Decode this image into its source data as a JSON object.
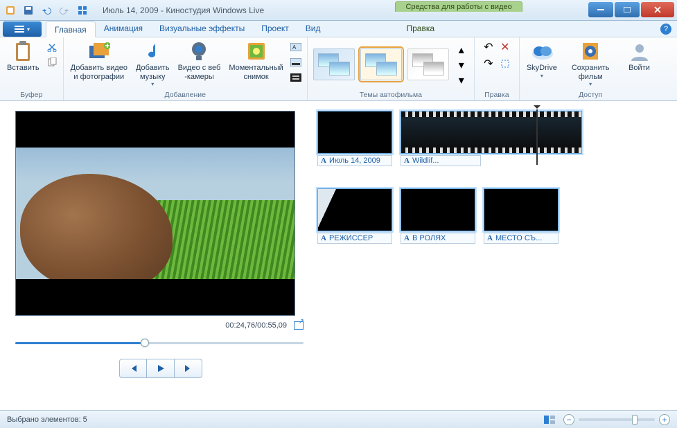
{
  "title": "Июль 14, 2009 - Киностудия Windows Live",
  "context_header": "Средства для работы с видео",
  "tabs": {
    "home": "Главная",
    "animation": "Анимация",
    "effects": "Визуальные эффекты",
    "project": "Проект",
    "view": "Вид",
    "edit": "Правка"
  },
  "ribbon": {
    "buffer": {
      "label": "Буфер",
      "paste": "Вставить"
    },
    "add": {
      "label": "Добавление",
      "add_media": "Добавить видео\nи фотографии",
      "add_music": "Добавить\nмузыку",
      "webcam": "Видео с веб\n-камеры",
      "snapshot": "Моментальный\nснимок"
    },
    "themes": {
      "label": "Темы автофильма"
    },
    "edit": {
      "label": "Правка"
    },
    "share": {
      "label": "Доступ",
      "skydrive": "SkyDrive",
      "save_movie": "Сохранить\nфильм",
      "signin": "Войти"
    }
  },
  "preview": {
    "time": "00:24,76/00:55,09",
    "seek_percent": 45
  },
  "clips": {
    "row1": [
      {
        "id": "title1",
        "caption": "Июль 14, 2009"
      },
      {
        "id": "wildlife",
        "caption": "Wildlif..."
      }
    ],
    "row2": [
      {
        "id": "director",
        "caption": "РЕЖИССЕР"
      },
      {
        "id": "cast",
        "caption": "В РОЛЯХ"
      },
      {
        "id": "location",
        "caption": "МЕСТО СЪ..."
      }
    ]
  },
  "status": {
    "selection": "Выбрано элементов: 5",
    "zoom_percent": 70
  }
}
